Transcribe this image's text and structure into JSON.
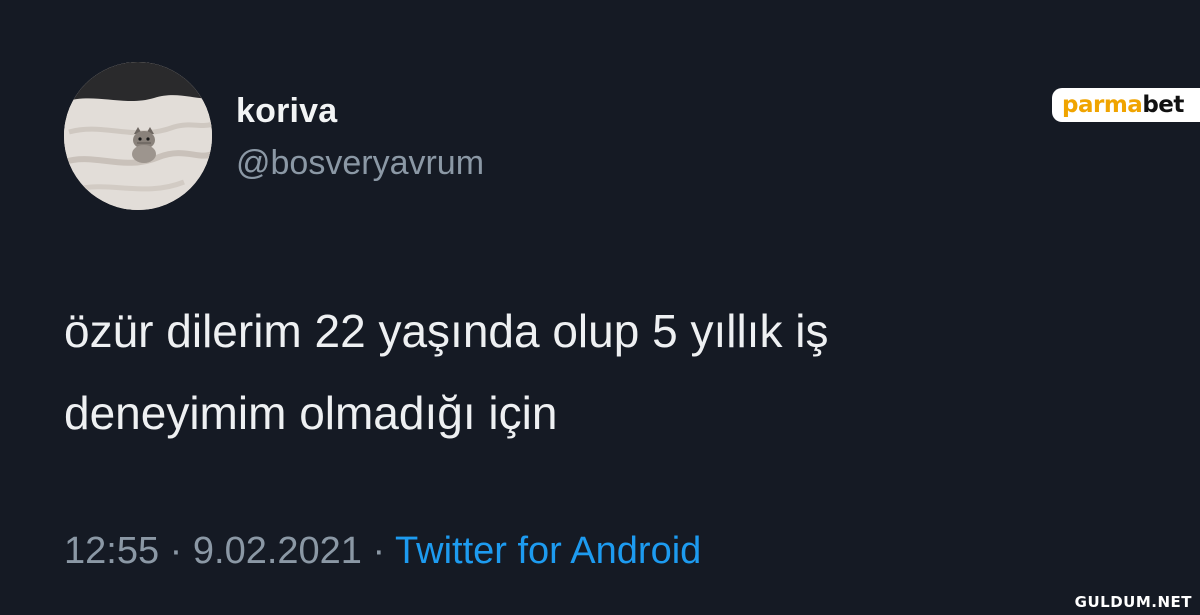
{
  "tweet": {
    "display_name": "koriva",
    "handle": "@bosveryavrum",
    "text_lines": [
      "özür dilerim 22 yaşında olup 5 yıllık iş",
      "deneyimim olmadığı için"
    ],
    "time": "12:55",
    "separator": "·",
    "date": "9.02.2021",
    "source": "Twitter for Android",
    "avatar_icon": "cat-on-bed-avatar"
  },
  "brand": {
    "part1": "parma",
    "part2": "bet"
  },
  "watermark": "GULDUM.NET",
  "colors": {
    "background": "#151a24",
    "text": "#eef0f2",
    "secondary": "#8b98a5",
    "link": "#1d9bf0",
    "brand_accent": "#f0a400"
  }
}
